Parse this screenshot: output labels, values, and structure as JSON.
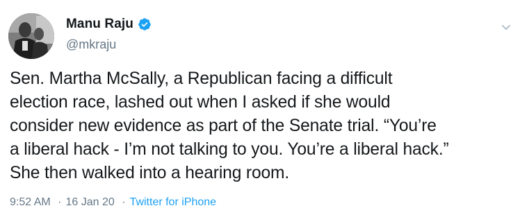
{
  "author": {
    "display_name": "Manu Raju",
    "handle": "@mkraju",
    "verified_icon": "verified-badge-icon",
    "avatar_icon": "profile-photo"
  },
  "menu": {
    "icon": "chevron-down-icon"
  },
  "tweet": {
    "lines": [
      "Sen. Martha McSally, a Republican facing a difficult",
      "election race, lashed out when I asked if she would",
      "consider new evidence as part of the Senate trial. “You’re",
      "a liberal hack - I’m not talking to you. You’re a liberal hack.”",
      "She then walked into a hearing room."
    ]
  },
  "meta": {
    "time": "9:52 AM",
    "separator": "·",
    "date": "16 Jan 20",
    "source": "Twitter for iPhone"
  },
  "colors": {
    "text": "#14171a",
    "secondary": "#657786",
    "link": "#1da1f2",
    "verified": "#1da1f2"
  }
}
